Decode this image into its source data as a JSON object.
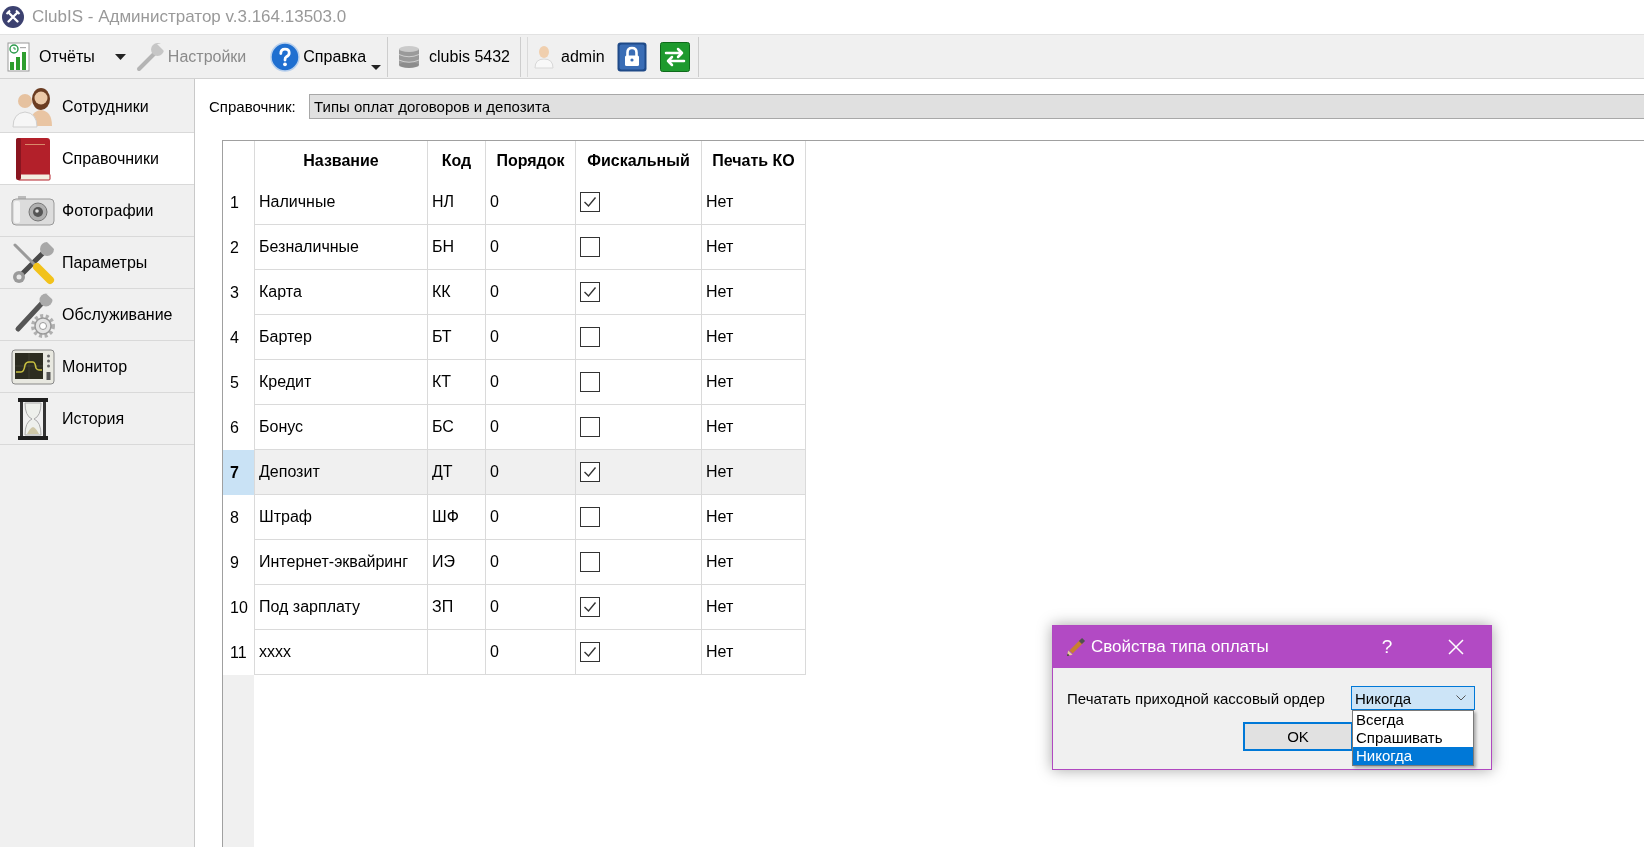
{
  "window": {
    "title": "ClubIS - Администратор v.3.164.13503.0"
  },
  "toolbar": {
    "reports": {
      "label": "Отчёты"
    },
    "settings": {
      "label": "Настройки",
      "disabled": true
    },
    "help": {
      "label": "Справка"
    },
    "database": {
      "label": "clubis 5432"
    },
    "user": {
      "label": "admin"
    }
  },
  "sidebar": {
    "items": [
      {
        "label": "Сотрудники",
        "selected": false
      },
      {
        "label": "Справочники",
        "selected": true
      },
      {
        "label": "Фотографии",
        "selected": false
      },
      {
        "label": "Параметры",
        "selected": false
      },
      {
        "label": "Обслуживание",
        "selected": false
      },
      {
        "label": "Монитор",
        "selected": false
      },
      {
        "label": "История",
        "selected": false
      }
    ]
  },
  "directory": {
    "label": "Справочник:",
    "value": "Типы оплат договоров и депозита"
  },
  "table": {
    "columns": [
      "Название",
      "Код",
      "Порядок",
      "Фискальный",
      "Печать КО"
    ],
    "rows": [
      {
        "number": "1",
        "name": "Наличные",
        "code": "НЛ",
        "order": "0",
        "fiscal": true,
        "print_ko": "Нет",
        "selected": false
      },
      {
        "number": "2",
        "name": "Безналичные",
        "code": "БН",
        "order": "0",
        "fiscal": false,
        "print_ko": "Нет",
        "selected": false
      },
      {
        "number": "3",
        "name": "Карта",
        "code": "КК",
        "order": "0",
        "fiscal": true,
        "print_ko": "Нет",
        "selected": false
      },
      {
        "number": "4",
        "name": "Бартер",
        "code": "БТ",
        "order": "0",
        "fiscal": false,
        "print_ko": "Нет",
        "selected": false
      },
      {
        "number": "5",
        "name": "Кредит",
        "code": "КТ",
        "order": "0",
        "fiscal": false,
        "print_ko": "Нет",
        "selected": false
      },
      {
        "number": "6",
        "name": "Бонус",
        "code": "БС",
        "order": "0",
        "fiscal": false,
        "print_ko": "Нет",
        "selected": false
      },
      {
        "number": "7",
        "name": "Депозит",
        "code": "ДТ",
        "order": "0",
        "fiscal": true,
        "print_ko": "Нет",
        "selected": true
      },
      {
        "number": "8",
        "name": "Штраф",
        "code": "ШФ",
        "order": "0",
        "fiscal": false,
        "print_ko": "Нет",
        "selected": false
      },
      {
        "number": "9",
        "name": "Интернет-эквайринг",
        "code": "ИЭ",
        "order": "0",
        "fiscal": false,
        "print_ko": "Нет",
        "selected": false
      },
      {
        "number": "10",
        "name": "Под зарплату",
        "code": "ЗП",
        "order": "0",
        "fiscal": true,
        "print_ko": "Нет",
        "selected": false
      },
      {
        "number": "11",
        "name": "xxxx",
        "order": "0",
        "fiscal": true,
        "print_ko": "Нет",
        "selected": false
      }
    ]
  },
  "dialog": {
    "title": "Свойства типа оплаты",
    "help_button": "?",
    "field": {
      "label": "Печатать приходной кассовый ордер",
      "value": "Никогда",
      "expanded": true,
      "options": [
        {
          "label": "Всегда",
          "selected": false
        },
        {
          "label": "Спрашивать",
          "selected": false
        },
        {
          "label": "Никогда",
          "selected": true
        }
      ]
    },
    "ok_button": "OK"
  }
}
